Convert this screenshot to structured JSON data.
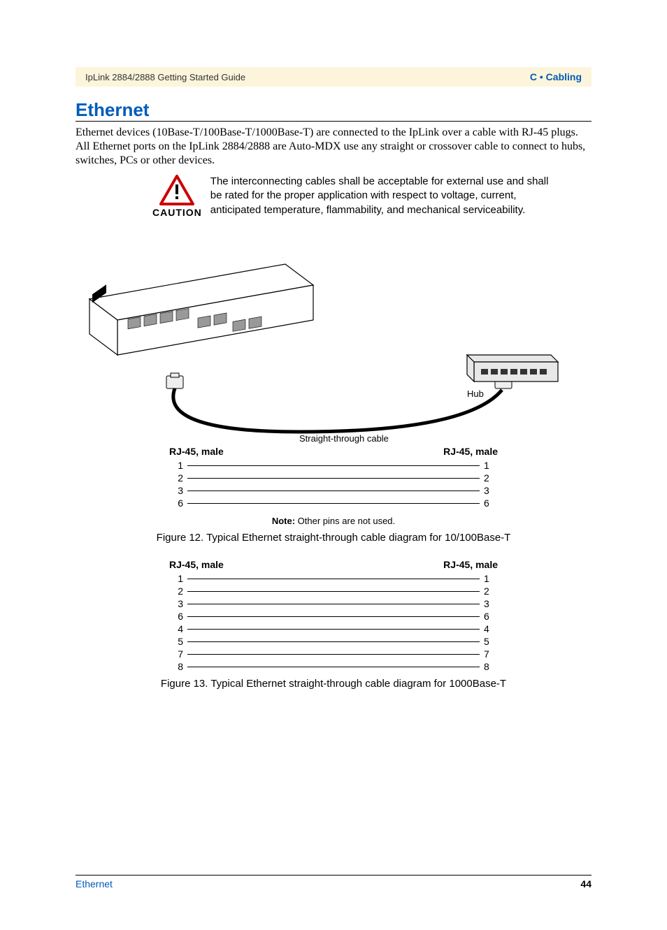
{
  "header": {
    "doc_title": "IpLink 2884/2888 Getting Started Guide",
    "section_ref": "C • Cabling"
  },
  "section": {
    "title": "Ethernet",
    "intro": "Ethernet devices (10Base-T/100Base-T/1000Base-T) are connected to the IpLink over a cable with RJ-45 plugs. All Ethernet ports on the IpLink 2884/2888 are Auto-MDX use any straight or crossover cable to connect to hubs, switches, PCs or other devices."
  },
  "caution": {
    "label": "CAUTION",
    "text": "The interconnecting cables shall be acceptable for external use and shall be rated for the proper application with respect to voltage, current, anticipated temperature, flammability, and mechanical serviceability."
  },
  "diagram": {
    "hub_label": "Hub",
    "cable_label": "Straight-through cable"
  },
  "pinout1": {
    "left_header": "RJ-45, male",
    "right_header": "RJ-45, male",
    "pins": [
      {
        "l": "1",
        "r": "1"
      },
      {
        "l": "2",
        "r": "2"
      },
      {
        "l": "3",
        "r": "3"
      },
      {
        "l": "6",
        "r": "6"
      }
    ],
    "note_label": "Note:",
    "note_text": " Other pins are not used.",
    "caption": "Figure 12. Typical Ethernet straight-through cable diagram for 10/100Base-T"
  },
  "pinout2": {
    "left_header": "RJ-45, male",
    "right_header": "RJ-45, male",
    "pins": [
      {
        "l": "1",
        "r": "1"
      },
      {
        "l": "2",
        "r": "2"
      },
      {
        "l": "3",
        "r": "3"
      },
      {
        "l": "6",
        "r": "6"
      },
      {
        "l": "4",
        "r": "4"
      },
      {
        "l": "5",
        "r": "5"
      },
      {
        "l": "7",
        "r": "7"
      },
      {
        "l": "8",
        "r": "8"
      }
    ],
    "caption": "Figure 13. Typical Ethernet straight-through cable diagram for 1000Base-T"
  },
  "footer": {
    "section": "Ethernet",
    "page": "44"
  }
}
